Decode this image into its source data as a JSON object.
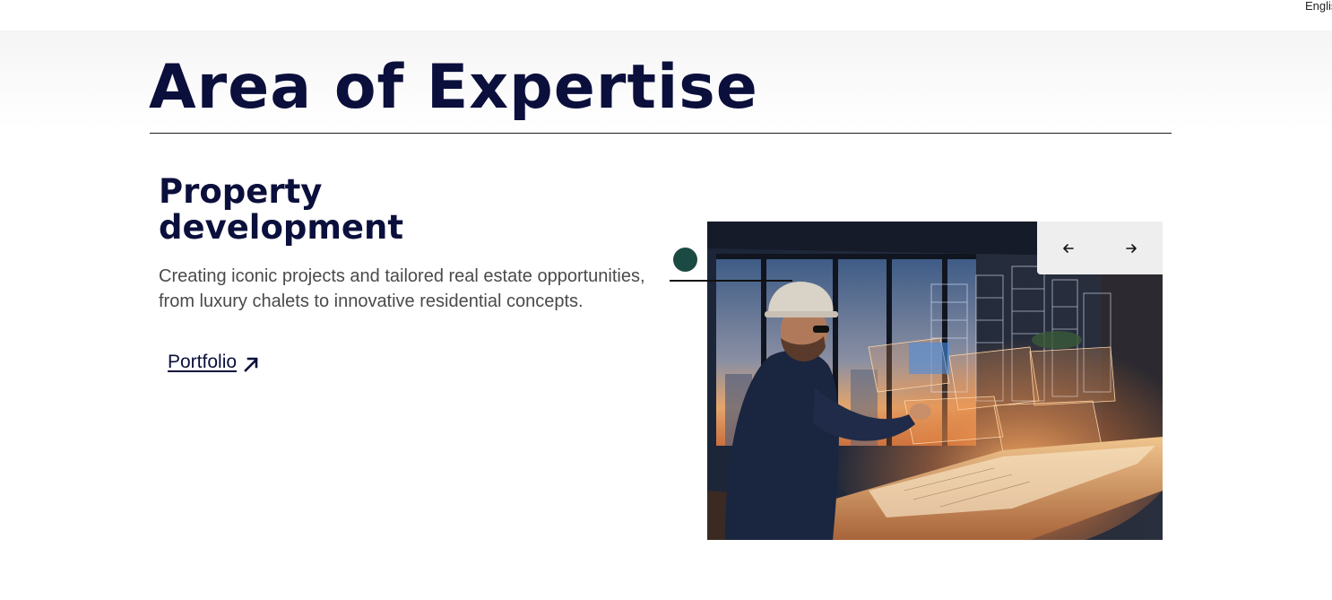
{
  "language": {
    "label": "English"
  },
  "section": {
    "title": "Area of Expertise"
  },
  "service": {
    "heading": "Property development",
    "description": "Creating iconic projects and tailored real estate opportunities, from luxury chalets to innovative residential concepts.",
    "link_label": "Portfolio"
  },
  "carousel": {
    "image_alt": "Architect with hard hat viewing holographic building model"
  },
  "colors": {
    "navy": "#0b0f3c",
    "accent_dot": "#1b4a43",
    "nav_box": "#eeeeee"
  },
  "icons": {
    "link": "arrow-up-right-icon",
    "prev": "arrow-left-icon",
    "next": "arrow-right-icon"
  }
}
